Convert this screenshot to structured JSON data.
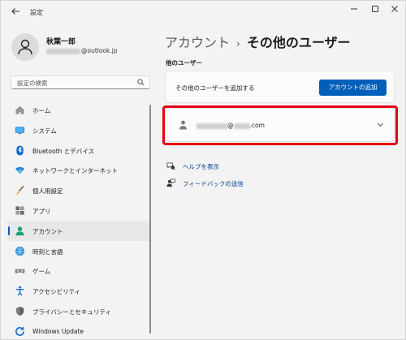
{
  "window": {
    "title": "設定",
    "back_icon": "back-arrow-icon",
    "controls": [
      "minimize",
      "maximize",
      "close"
    ]
  },
  "user": {
    "name": "秋葉一郎",
    "email_suffix": "@outlook.jp"
  },
  "search": {
    "placeholder": "設定の検索"
  },
  "nav": {
    "items": [
      {
        "label": "ホーム",
        "icon": "home-icon"
      },
      {
        "label": "システム",
        "icon": "system-icon"
      },
      {
        "label": "Bluetooth とデバイス",
        "icon": "bluetooth-icon"
      },
      {
        "label": "ネットワークとインターネット",
        "icon": "network-icon"
      },
      {
        "label": "個人用設定",
        "icon": "personalization-icon"
      },
      {
        "label": "アプリ",
        "icon": "apps-icon"
      },
      {
        "label": "アカウント",
        "icon": "accounts-icon",
        "selected": true
      },
      {
        "label": "時刻と言語",
        "icon": "time-language-icon"
      },
      {
        "label": "ゲーム",
        "icon": "gaming-icon"
      },
      {
        "label": "アクセシビリティ",
        "icon": "accessibility-icon"
      },
      {
        "label": "プライバシーとセキュリティ",
        "icon": "privacy-icon"
      },
      {
        "label": "Windows Update",
        "icon": "windows-update-icon"
      }
    ]
  },
  "main": {
    "breadcrumb_parent": "アカウント",
    "breadcrumb_sep": "›",
    "breadcrumb_current": "その他のユーザー",
    "section_title": "他のユーザー",
    "add_user_label": "その他のユーザーを追加する",
    "add_account_button": "アカウントの追加",
    "account_email_at": "@",
    "account_email_domain": ".com",
    "help_link": "ヘルプを表示",
    "feedback_link": "フィードバックの送信"
  },
  "colors": {
    "accent": "#005fb8",
    "highlight": "#e60012",
    "link": "#003e92"
  }
}
